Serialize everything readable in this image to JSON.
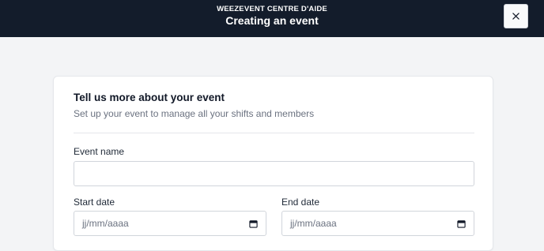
{
  "header": {
    "brand": "WEEZEVENT CENTRE D'AIDE",
    "title": "Creating an event",
    "close_label": "×"
  },
  "card": {
    "title": "Tell us more about your event",
    "subtitle": "Set up your event to manage all your shifts and members"
  },
  "form": {
    "event_name": {
      "label": "Event name",
      "value": ""
    },
    "start_date": {
      "label": "Start date",
      "placeholder": "jj/mm/aaaa"
    },
    "end_date": {
      "label": "End date",
      "placeholder": "jj/mm/aaaa"
    }
  },
  "icons": {
    "close": "close-icon",
    "calendar": "calendar-icon"
  },
  "colors": {
    "header_bg": "#131c2b",
    "page_bg": "#f3f4f6",
    "card_bg": "#ffffff"
  }
}
